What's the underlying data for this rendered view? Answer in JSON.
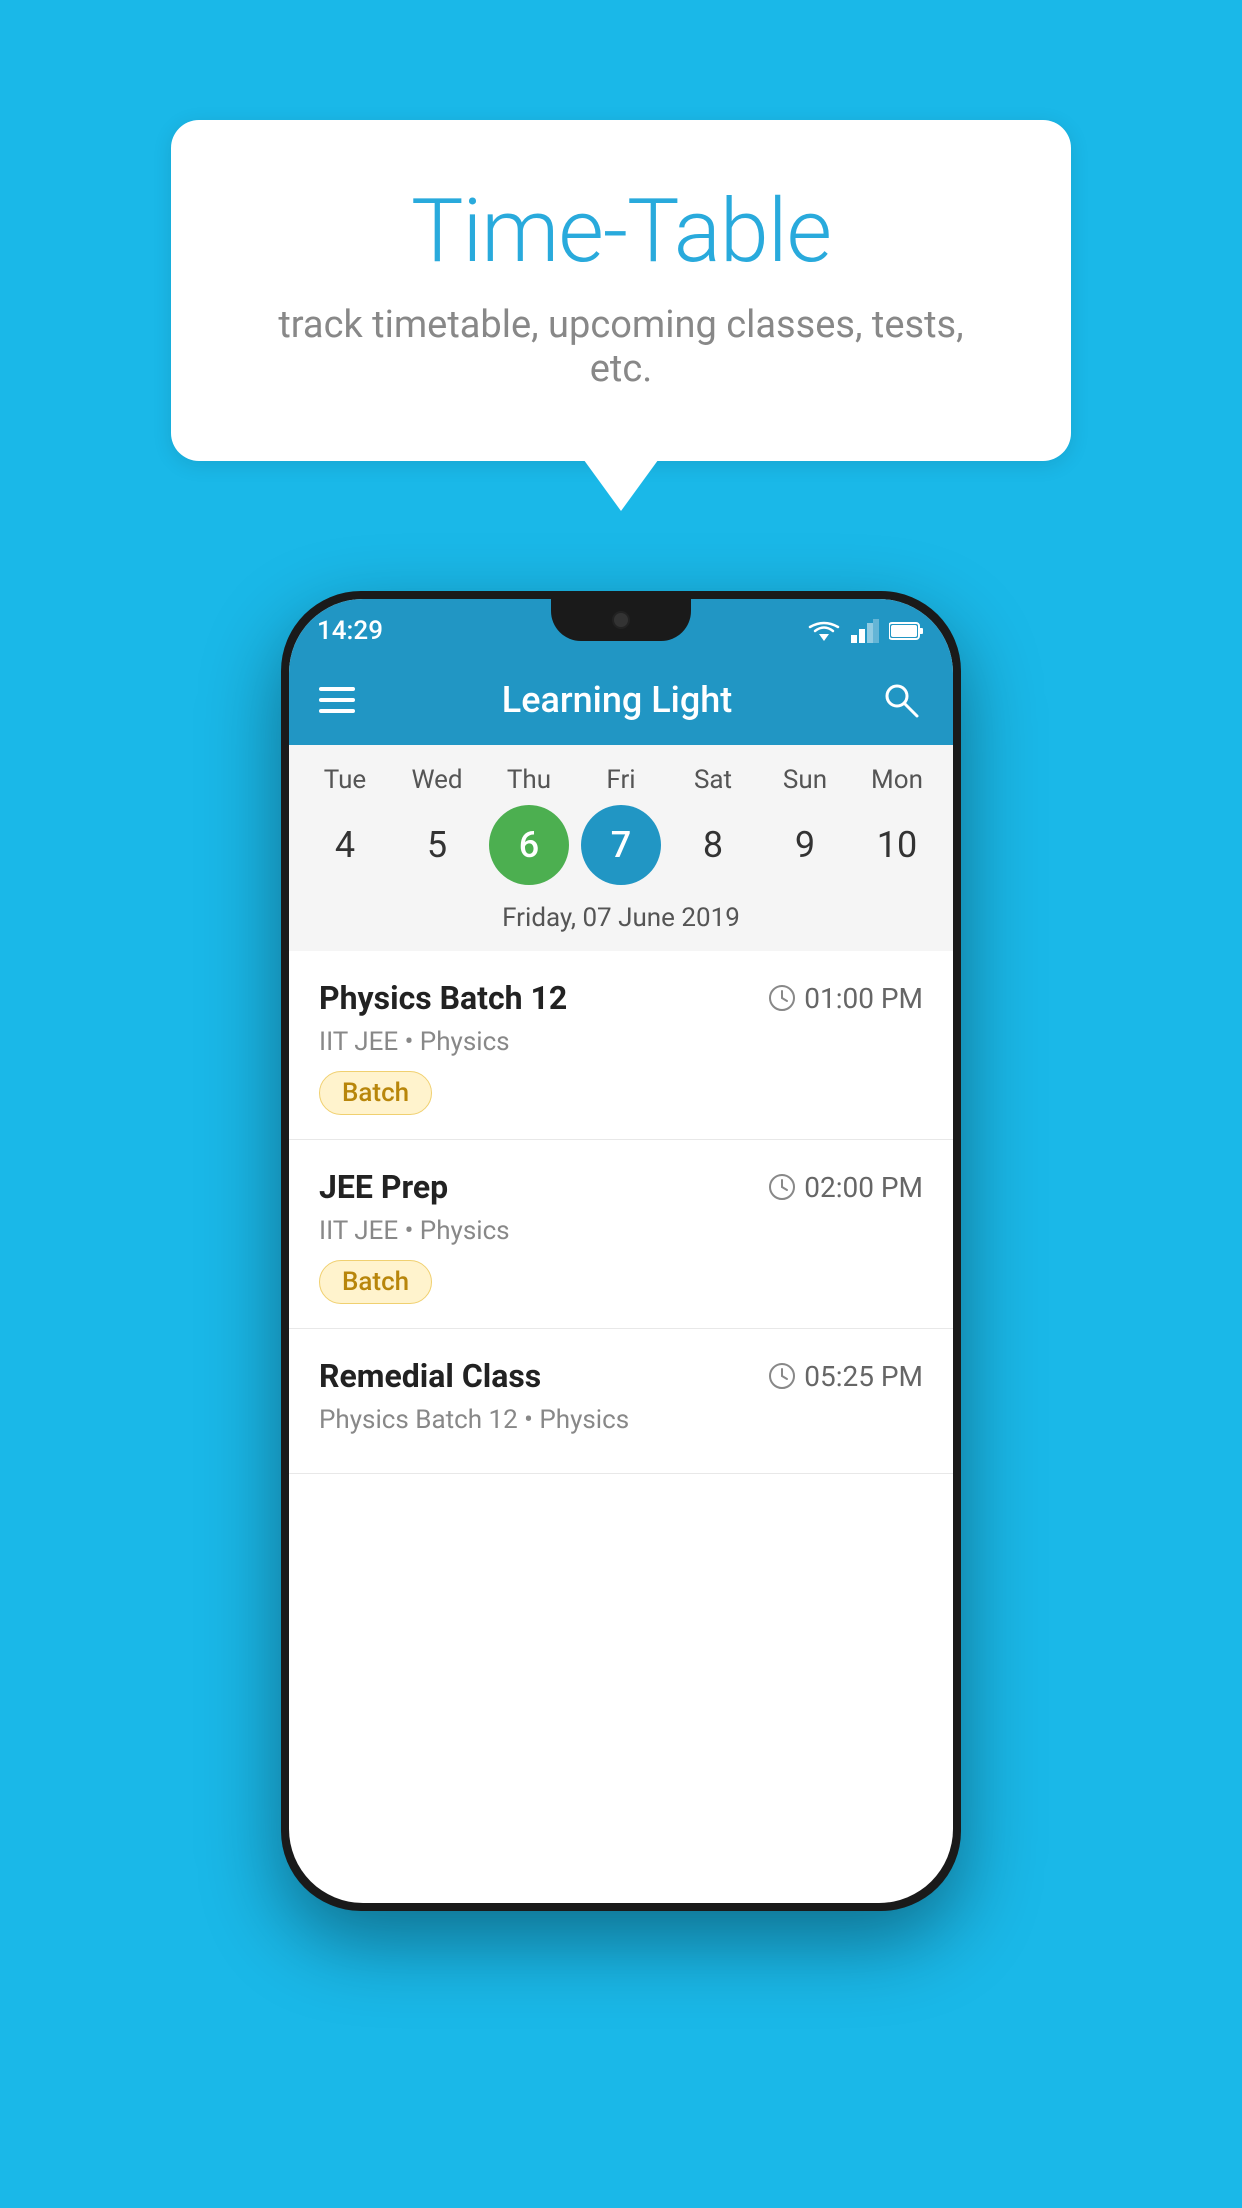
{
  "page": {
    "background_color": "#1ab8e8"
  },
  "hero": {
    "title": "Time-Table",
    "subtitle": "track timetable, upcoming classes, tests, etc."
  },
  "phone": {
    "status_bar": {
      "time": "14:29"
    },
    "app_bar": {
      "title": "Learning Light"
    },
    "calendar": {
      "days": [
        "Tue",
        "Wed",
        "Thu",
        "Fri",
        "Sat",
        "Sun",
        "Mon"
      ],
      "dates": [
        "4",
        "5",
        "6",
        "7",
        "8",
        "9",
        "10"
      ],
      "today_index": 2,
      "selected_index": 3,
      "selected_date_label": "Friday, 07 June 2019"
    },
    "schedule": [
      {
        "title": "Physics Batch 12",
        "time": "01:00 PM",
        "subtitle": "IIT JEE • Physics",
        "tag": "Batch"
      },
      {
        "title": "JEE Prep",
        "time": "02:00 PM",
        "subtitle": "IIT JEE • Physics",
        "tag": "Batch"
      },
      {
        "title": "Remedial Class",
        "time": "05:25 PM",
        "subtitle": "Physics Batch 12 • Physics",
        "tag": null
      }
    ]
  }
}
